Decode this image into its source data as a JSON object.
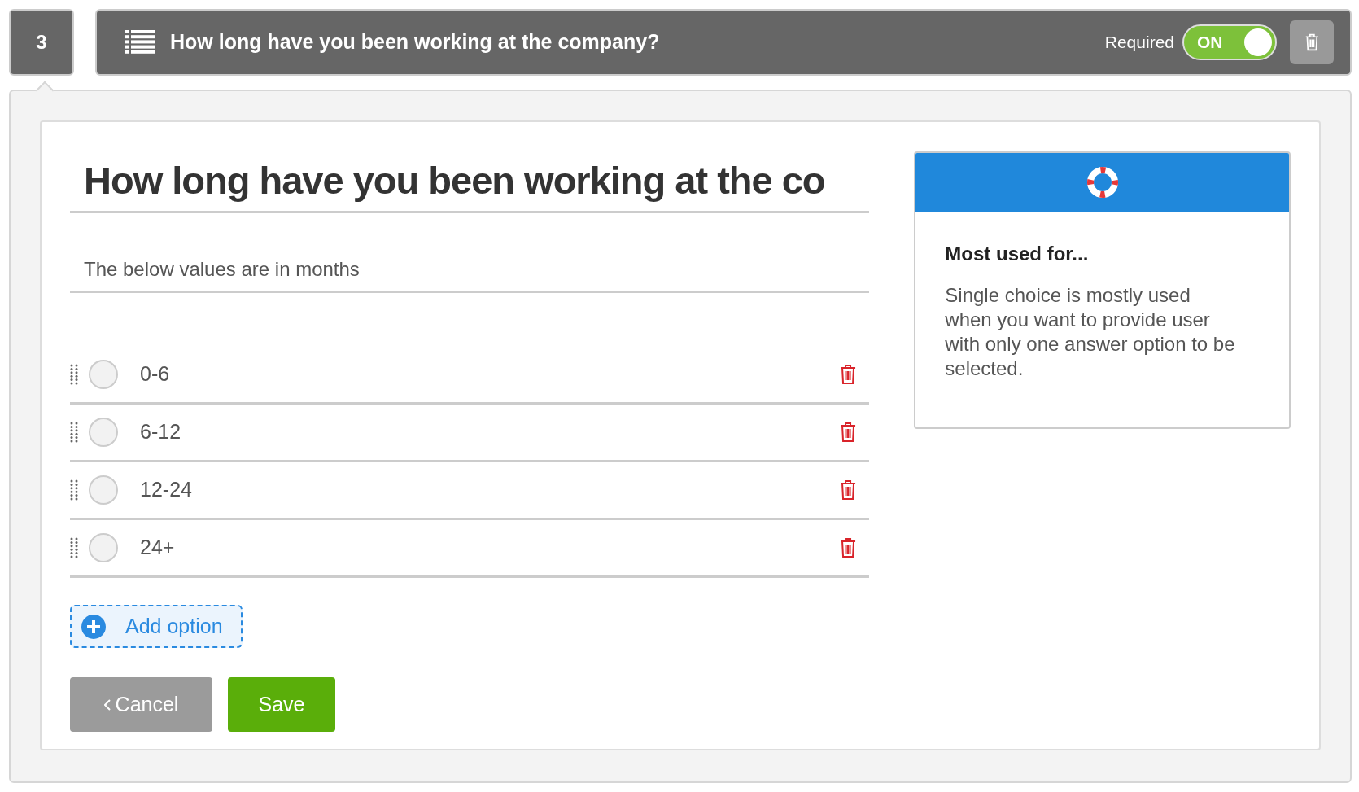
{
  "question_number": "3",
  "header": {
    "title": "How long have you been working at the company?",
    "required_label": "Required",
    "required_toggle": {
      "label": "ON",
      "on": true
    }
  },
  "editor": {
    "title_value": "How long have you been working at the co",
    "description_value": "The below values are in months",
    "options": [
      {
        "value": "0-6",
        "selected": false
      },
      {
        "value": "6-12",
        "selected": false
      },
      {
        "value": "12-24",
        "selected": false
      },
      {
        "value": "24+",
        "selected": false
      }
    ],
    "add_option": "Add option",
    "buttons": [
      {
        "label": "Cancel",
        "kind": "cancel"
      },
      {
        "label": "Save",
        "kind": "save"
      }
    ]
  },
  "help": {
    "heading": "Most used for...",
    "text": "Single choice is mostly used when you want to provide user with only one answer option to be selected."
  }
}
